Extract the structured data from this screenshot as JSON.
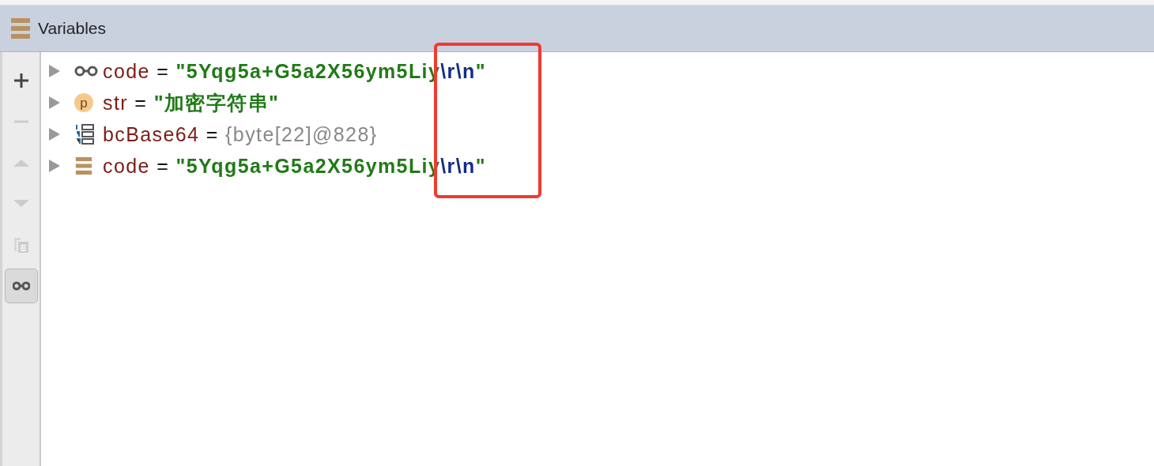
{
  "panel": {
    "title": "Variables"
  },
  "toolbar": [
    {
      "kind": "plus",
      "disabled": false,
      "selected": false
    },
    {
      "kind": "minus",
      "disabled": true,
      "selected": false
    },
    {
      "kind": "up",
      "disabled": true,
      "selected": false
    },
    {
      "kind": "down",
      "disabled": true,
      "selected": false
    },
    {
      "kind": "copy",
      "disabled": true,
      "selected": false
    },
    {
      "kind": "watch",
      "disabled": false,
      "selected": true
    }
  ],
  "variables": [
    {
      "kind": "watch",
      "name": "code",
      "equals": "=",
      "value": [
        {
          "kind": "string",
          "text": "\"5Yqg5a+G5a2X56ym5Liy"
        },
        {
          "kind": "escape",
          "text": "\\r\\n"
        },
        {
          "kind": "string",
          "text": "\""
        }
      ]
    },
    {
      "kind": "param",
      "name": "str",
      "equals": "=",
      "badge": "p",
      "value": [
        {
          "kind": "string",
          "text": "\"加密字符串\""
        }
      ]
    },
    {
      "kind": "array",
      "name": "bcBase64",
      "equals": "=",
      "value": [
        {
          "kind": "object",
          "text": "{byte[22]@828}"
        }
      ]
    },
    {
      "kind": "field",
      "name": "code",
      "equals": "=",
      "value": [
        {
          "kind": "string",
          "text": "\"5Yqg5a+G5a2X56ym5Liy"
        },
        {
          "kind": "escape",
          "text": "\\r\\n"
        },
        {
          "kind": "string",
          "text": "\""
        }
      ]
    }
  ],
  "annotation": {
    "kind": "highlight-frame",
    "color": "#f03a2e"
  }
}
